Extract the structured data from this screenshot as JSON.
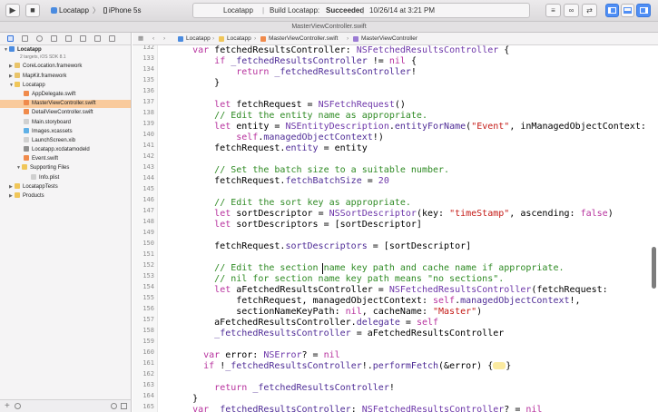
{
  "toolbar": {
    "run_icon": "play-icon",
    "stop_icon": "stop-icon",
    "scheme_app": "Locatapp",
    "scheme_sep": "〉",
    "scheme_device": "iPhone 5s",
    "status_app": "Locatapp",
    "status_build_prefix": "Build Locatapp:",
    "status_build_result": "Succeeded",
    "status_timestamp": "10/26/14 at 3:21 PM"
  },
  "tab": {
    "title": "MasterViewController.swift"
  },
  "jumpbar": {
    "items": [
      "Locatapp",
      "Locatapp",
      "MasterViewController.swift",
      "MasterViewController"
    ]
  },
  "navigator": {
    "project": "Locatapp",
    "project_sub": "2 targets, iOS SDK 8.1",
    "items": [
      "CoreLocation.framework",
      "MapKit.framework",
      "Locatapp",
      "AppDelegate.swift",
      "MasterViewController.swift",
      "DetailViewController.swift",
      "Main.storyboard",
      "Images.xcassets",
      "LaunchScreen.xib",
      "Locatapp.xcdatamodeld",
      "Event.swift",
      "Supporting Files",
      "Info.plist",
      "LocatappTests",
      "Products"
    ]
  },
  "code": {
    "line_numbers": [
      "132",
      "133",
      "134",
      "135",
      "136",
      "137",
      "138",
      "139",
      "140",
      "141",
      "142",
      "143",
      "144",
      "145",
      "146",
      "147",
      "148",
      "149",
      "150",
      "151",
      "152",
      "153",
      "154",
      "155",
      "156",
      "157",
      "158",
      "159",
      "160",
      "161",
      "162",
      "163",
      "164",
      "165",
      "166",
      "167"
    ]
  }
}
